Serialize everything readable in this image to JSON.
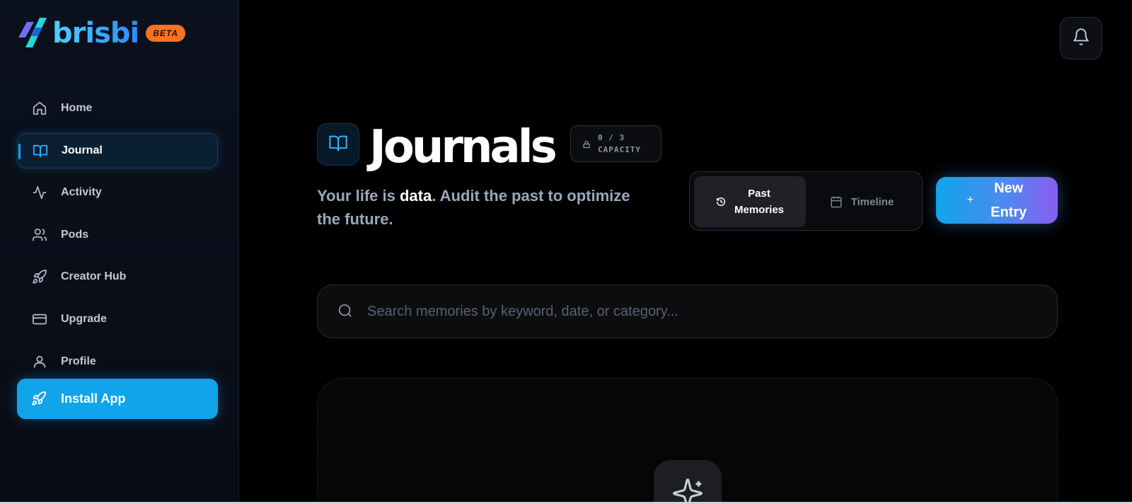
{
  "brand": {
    "name": "brisbi",
    "badge": "BETA"
  },
  "sidebar": {
    "items": [
      {
        "label": "Home",
        "icon": "home-icon"
      },
      {
        "label": "Journal",
        "icon": "book-open-icon",
        "active": true
      },
      {
        "label": "Activity",
        "icon": "activity-icon"
      },
      {
        "label": "Pods",
        "icon": "users-icon"
      },
      {
        "label": "Creator Hub",
        "icon": "rocket-icon"
      },
      {
        "label": "Upgrade",
        "icon": "credit-card-icon"
      },
      {
        "label": "Profile",
        "icon": "user-icon"
      }
    ],
    "install_label": "Install App"
  },
  "header": {
    "title": "Journals",
    "capacity_count": "0 / 3",
    "capacity_label": "CAPACITY",
    "subtitle_pre": "Your life is ",
    "subtitle_highlight": "data",
    "subtitle_post": ". Audit the past to optimize the future."
  },
  "view_toggle": {
    "past_line1": "Past",
    "past_line2": "Memories",
    "timeline": "Timeline"
  },
  "new_entry": {
    "plus": "+",
    "line1": "New",
    "line2": "Entry"
  },
  "search": {
    "placeholder": "Search memories by keyword, date, or category..."
  },
  "colors": {
    "accent": "#10a4ea",
    "beta": "#f57421",
    "gradient_end": "#8a5cf0"
  }
}
